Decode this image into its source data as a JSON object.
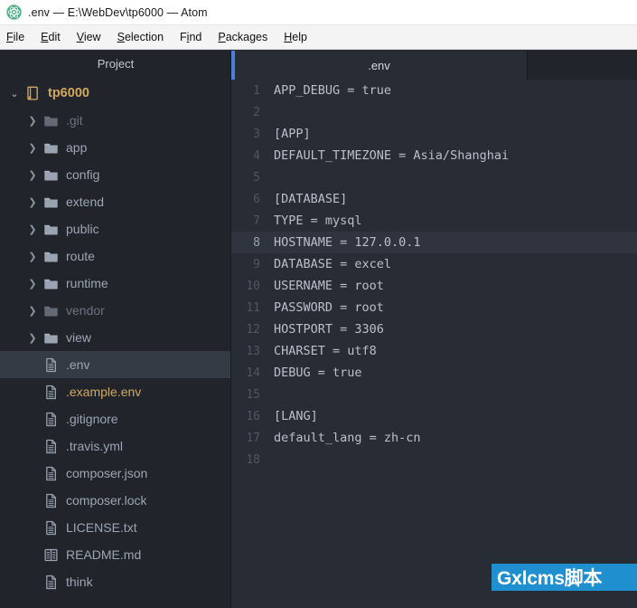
{
  "window": {
    "title": ".env — E:\\WebDev\\tp6000 — Atom",
    "logo_icon": "atom-logo-icon"
  },
  "menubar": {
    "items": [
      {
        "label": "File",
        "accel": "F"
      },
      {
        "label": "Edit",
        "accel": "E"
      },
      {
        "label": "View",
        "accel": "V"
      },
      {
        "label": "Selection",
        "accel": "S"
      },
      {
        "label": "Find",
        "accel": "i"
      },
      {
        "label": "Packages",
        "accel": "P"
      },
      {
        "label": "Help",
        "accel": "H"
      }
    ]
  },
  "sidebar": {
    "header": "Project",
    "items": [
      {
        "label": "tp6000",
        "type": "repo",
        "depth": 0,
        "expanded": true,
        "state": "root"
      },
      {
        "label": ".git",
        "type": "folder",
        "depth": 1,
        "expanded": false,
        "state": "ignored"
      },
      {
        "label": "app",
        "type": "folder",
        "depth": 1,
        "expanded": false,
        "state": "normal"
      },
      {
        "label": "config",
        "type": "folder",
        "depth": 1,
        "expanded": false,
        "state": "normal"
      },
      {
        "label": "extend",
        "type": "folder",
        "depth": 1,
        "expanded": false,
        "state": "normal"
      },
      {
        "label": "public",
        "type": "folder",
        "depth": 1,
        "expanded": false,
        "state": "normal"
      },
      {
        "label": "route",
        "type": "folder",
        "depth": 1,
        "expanded": false,
        "state": "normal"
      },
      {
        "label": "runtime",
        "type": "folder",
        "depth": 1,
        "expanded": false,
        "state": "normal"
      },
      {
        "label": "vendor",
        "type": "folder",
        "depth": 1,
        "expanded": false,
        "state": "ignored"
      },
      {
        "label": "view",
        "type": "folder",
        "depth": 1,
        "expanded": false,
        "state": "normal"
      },
      {
        "label": ".env",
        "type": "file",
        "depth": 2,
        "state": "selected"
      },
      {
        "label": ".example.env",
        "type": "file",
        "depth": 2,
        "state": "modified"
      },
      {
        "label": ".gitignore",
        "type": "file",
        "depth": 2,
        "state": "normal"
      },
      {
        "label": ".travis.yml",
        "type": "file",
        "depth": 2,
        "state": "normal"
      },
      {
        "label": "composer.json",
        "type": "file",
        "depth": 2,
        "state": "normal"
      },
      {
        "label": "composer.lock",
        "type": "file",
        "depth": 2,
        "state": "normal"
      },
      {
        "label": "LICENSE.txt",
        "type": "file",
        "depth": 2,
        "state": "normal"
      },
      {
        "label": "README.md",
        "type": "book",
        "depth": 2,
        "state": "normal"
      },
      {
        "label": "think",
        "type": "file",
        "depth": 2,
        "state": "normal"
      }
    ]
  },
  "editor": {
    "tabs": [
      {
        "label": ".env",
        "active": true
      }
    ],
    "active_line": 8,
    "lines": [
      {
        "n": 1,
        "text": "APP_DEBUG = true"
      },
      {
        "n": 2,
        "text": ""
      },
      {
        "n": 3,
        "text": "[APP]"
      },
      {
        "n": 4,
        "text": "DEFAULT_TIMEZONE = Asia/Shanghai"
      },
      {
        "n": 5,
        "text": ""
      },
      {
        "n": 6,
        "text": "[DATABASE]"
      },
      {
        "n": 7,
        "text": "TYPE = mysql"
      },
      {
        "n": 8,
        "text": "HOSTNAME = 127.0.0.1"
      },
      {
        "n": 9,
        "text": "DATABASE = excel"
      },
      {
        "n": 10,
        "text": "USERNAME = root"
      },
      {
        "n": 11,
        "text": "PASSWORD = root"
      },
      {
        "n": 12,
        "text": "HOSTPORT = 3306"
      },
      {
        "n": 13,
        "text": "CHARSET = utf8"
      },
      {
        "n": 14,
        "text": "DEBUG = true"
      },
      {
        "n": 15,
        "text": ""
      },
      {
        "n": 16,
        "text": "[LANG]"
      },
      {
        "n": 17,
        "text": "default_lang = zh-cn"
      },
      {
        "n": 18,
        "text": ""
      }
    ]
  },
  "watermark": {
    "text": "Gxlcms脚本",
    "background": "#1f8fd0",
    "color": "#ffffff"
  },
  "colors": {
    "titlebar_bg": "#ffffff",
    "menubar_bg": "#f4f4f4",
    "sidebar_bg": "#21252b",
    "editor_bg": "#282c34",
    "active_line_bg": "#2f343e",
    "selected_row_bg": "#353b45",
    "tab_accent": "#4a7fd4",
    "modified_gold": "#d2a85f",
    "text_primary": "#b9c0cc",
    "text_dim": "#6b7280"
  }
}
